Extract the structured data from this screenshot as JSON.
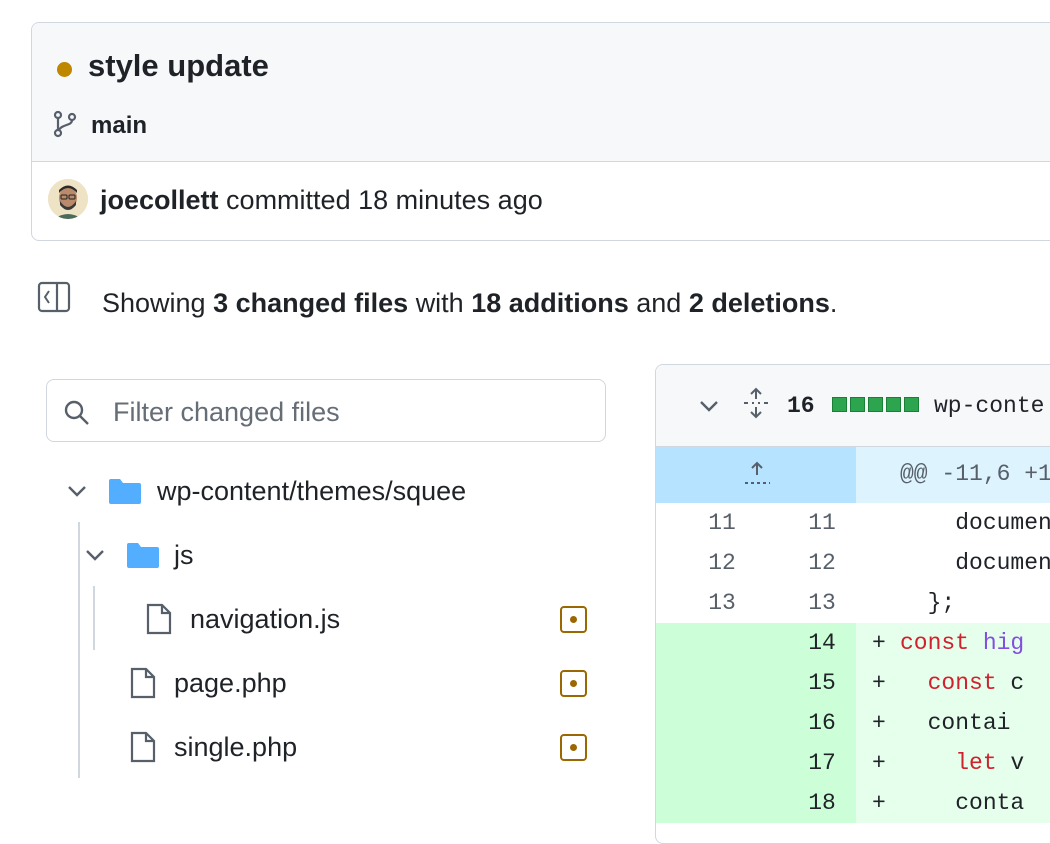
{
  "commit": {
    "title": "style update",
    "status_color": "#bf8700",
    "branch": "main",
    "author": "joecollett",
    "action": "committed",
    "time": "18 minutes ago"
  },
  "summary": {
    "prefix": "Showing",
    "files": "3 changed files",
    "with": "with",
    "additions": "18 additions",
    "and": "and",
    "deletions": "2 deletions",
    "suffix": "."
  },
  "filter": {
    "placeholder": "Filter changed files"
  },
  "tree": {
    "folder_root": "wp-content/themes/squee",
    "folder_js": "js",
    "file_navigation": "navigation.js",
    "file_page": "page.php",
    "file_single": "single.php"
  },
  "diff": {
    "count": "16",
    "file_path": "wp-conte",
    "hunk": "@@ -11,6 +1",
    "lines": [
      {
        "old": "11",
        "new": "11",
        "sign": "",
        "code": "    documen"
      },
      {
        "old": "12",
        "new": "12",
        "sign": "",
        "code": "    documen"
      },
      {
        "old": "13",
        "new": "13",
        "sign": "",
        "code": "  };"
      },
      {
        "old": "",
        "new": "14",
        "sign": "+",
        "kw": "const ",
        "rest": "hig"
      },
      {
        "old": "",
        "new": "15",
        "sign": "+",
        "kw": "  const ",
        "rest": "c"
      },
      {
        "old": "",
        "new": "16",
        "sign": "+",
        "kw": "",
        "rest": "  contai"
      },
      {
        "old": "",
        "new": "17",
        "sign": "+",
        "kw": "    let ",
        "rest": "v"
      },
      {
        "old": "",
        "new": "18",
        "sign": "+",
        "kw": "",
        "rest": "    conta"
      }
    ]
  }
}
